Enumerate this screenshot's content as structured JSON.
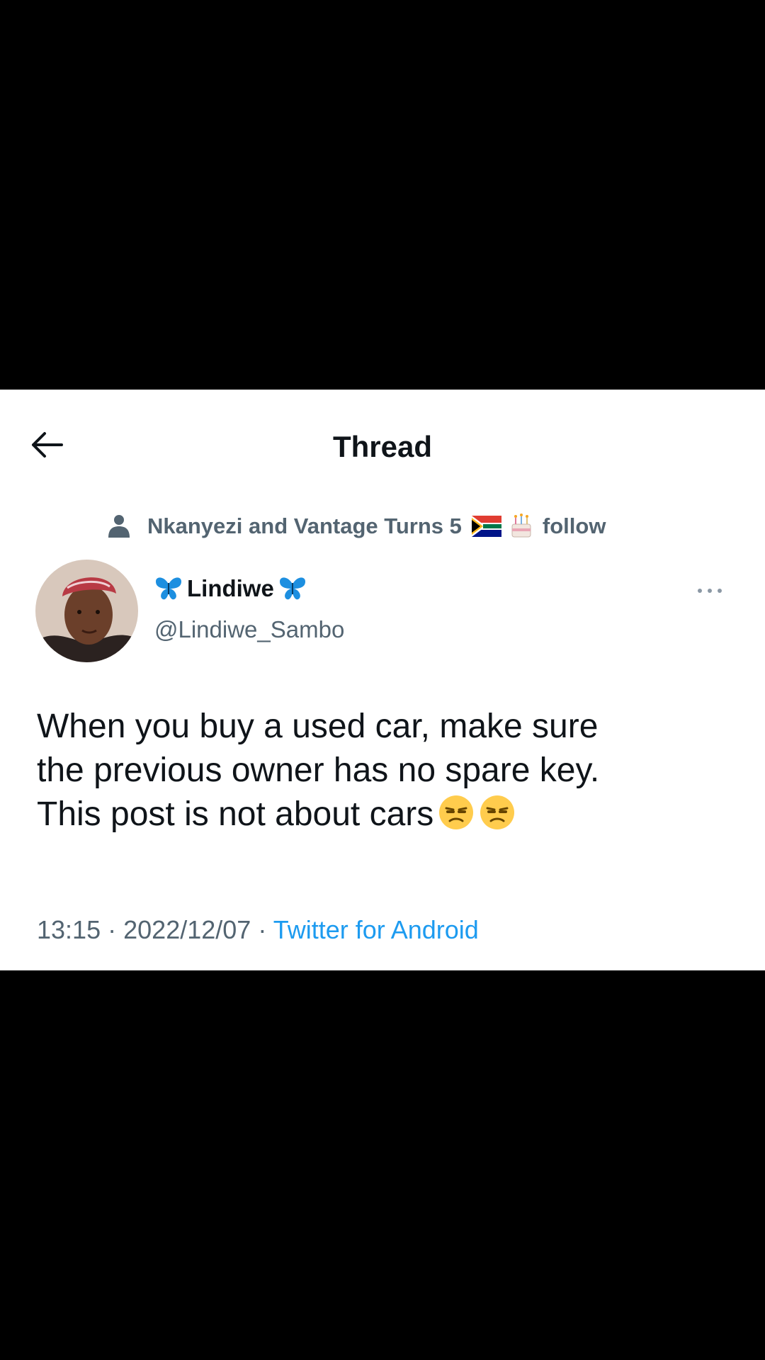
{
  "header": {
    "title": "Thread",
    "back_icon": "arrow-left-icon"
  },
  "social_context": {
    "text": "Nkanyezi and Vantage Turns 5",
    "action": "follow",
    "icons": [
      "person-icon",
      "south-africa-flag-icon",
      "birthday-cake-icon"
    ]
  },
  "tweet": {
    "display_name": "Lindiwe",
    "name_icons": [
      "butterfly-icon",
      "butterfly-icon"
    ],
    "handle": "@Lindiwe_Sambo",
    "text_lines": [
      "When you buy a used car, make sure",
      "the previous owner has no spare key.",
      "This post is not about cars"
    ],
    "text_emojis": [
      "unamused-face-icon",
      "unamused-face-icon"
    ],
    "time": "13:15",
    "date": "2022/12/07",
    "separator": "·",
    "source": "Twitter for Android",
    "more_icon": "more-dots-icon"
  },
  "colors": {
    "background": "#000000",
    "card": "#ffffff",
    "text_primary": "#0f1419",
    "text_secondary": "#536471",
    "link": "#1d9bf0",
    "butterfly": "#1d8fe0"
  }
}
